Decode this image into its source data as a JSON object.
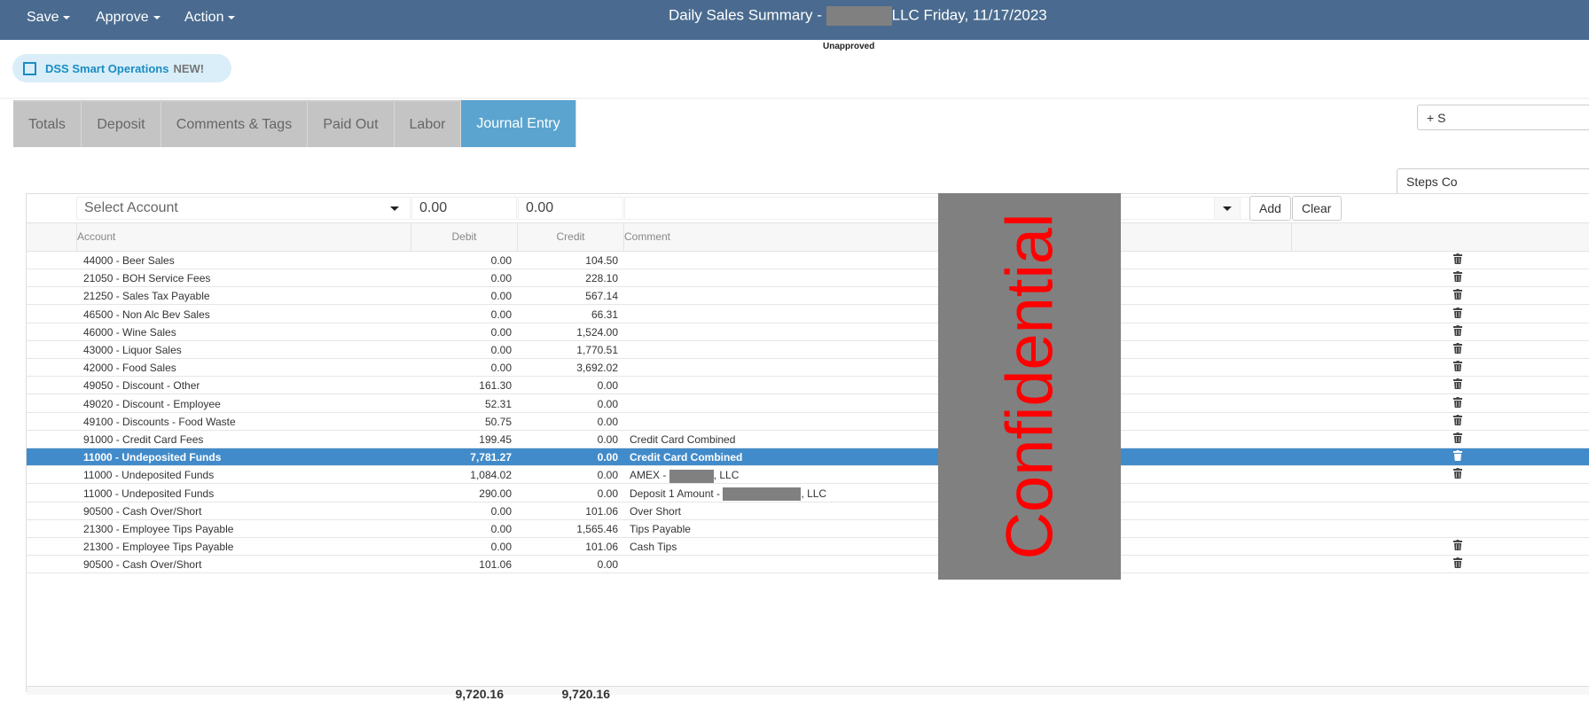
{
  "topbar": {
    "menus": [
      {
        "label": "Save"
      },
      {
        "label": "Approve"
      },
      {
        "label": "Action"
      }
    ],
    "title_prefix": "Daily Sales Summary -",
    "title_suffix": "LLC Friday, 11/17/2023",
    "status": "Unapproved"
  },
  "badge": {
    "label": "DSS Smart Operations",
    "new": "NEW!"
  },
  "tabs": [
    "Totals",
    "Deposit",
    "Comments & Tags",
    "Paid Out",
    "Labor",
    "Journal Entry"
  ],
  "active_tab": "Journal Entry",
  "buttons": {
    "add_section": "+ S",
    "steps": "Steps Co",
    "add": "Add",
    "clear": "Clear"
  },
  "entry": {
    "account_placeholder": "Select Account",
    "debit": "0.00",
    "credit": "0.00",
    "comment": ""
  },
  "columns": {
    "account": "Account",
    "debit": "Debit",
    "credit": "Credit",
    "comment": "Comment"
  },
  "rows": [
    {
      "account": "44000 - Beer Sales",
      "debit": "0.00",
      "credit": "104.50",
      "comment": "",
      "trash": true
    },
    {
      "account": "21050 - BOH Service Fees",
      "debit": "0.00",
      "credit": "228.10",
      "comment": "",
      "trash": true
    },
    {
      "account": "21250 - Sales Tax Payable",
      "debit": "0.00",
      "credit": "567.14",
      "comment": "",
      "trash": true
    },
    {
      "account": "46500 - Non Alc Bev Sales",
      "debit": "0.00",
      "credit": "66.31",
      "comment": "",
      "trash": true
    },
    {
      "account": "46000 - Wine Sales",
      "debit": "0.00",
      "credit": "1,524.00",
      "comment": "",
      "trash": true
    },
    {
      "account": "43000 - Liquor Sales",
      "debit": "0.00",
      "credit": "1,770.51",
      "comment": "",
      "trash": true
    },
    {
      "account": "42000 - Food Sales",
      "debit": "0.00",
      "credit": "3,692.02",
      "comment": "",
      "trash": true
    },
    {
      "account": "49050 - Discount - Other",
      "debit": "161.30",
      "credit": "0.00",
      "comment": "",
      "trash": true
    },
    {
      "account": "49020 - Discount - Employee",
      "debit": "52.31",
      "credit": "0.00",
      "comment": "",
      "trash": true
    },
    {
      "account": "49100 - Discounts - Food Waste",
      "debit": "50.75",
      "credit": "0.00",
      "comment": "",
      "trash": true
    },
    {
      "account": "91000 - Credit Card Fees",
      "debit": "199.45",
      "credit": "0.00",
      "comment": "Credit Card Combined",
      "trash": true
    },
    {
      "account": "11000 - Undeposited Funds",
      "debit": "7,781.27",
      "credit": "0.00",
      "comment": "Credit Card Combined",
      "trash": true,
      "selected": true
    },
    {
      "account": "11000 - Undeposited Funds",
      "debit": "1,084.02",
      "credit": "0.00",
      "comment": "AMEX -",
      "comment_suffix": ", LLC",
      "redact": 50,
      "trash": true
    },
    {
      "account": "11000 - Undeposited Funds",
      "debit": "290.00",
      "credit": "0.00",
      "comment": "Deposit 1 Amount -",
      "comment_suffix": ", LLC",
      "redact": 88,
      "trash": false
    },
    {
      "account": "90500 - Cash Over/Short",
      "debit": "0.00",
      "credit": "101.06",
      "comment": "Over Short",
      "trash": false
    },
    {
      "account": "21300 - Employee Tips Payable",
      "debit": "0.00",
      "credit": "1,565.46",
      "comment": "Tips Payable",
      "trash": false
    },
    {
      "account": "21300 - Employee Tips Payable",
      "debit": "0.00",
      "credit": "101.06",
      "comment": "Cash Tips",
      "trash": true
    },
    {
      "account": "90500 - Cash Over/Short",
      "debit": "101.06",
      "credit": "0.00",
      "comment": "",
      "trash": true
    }
  ],
  "totals": {
    "debit": "9,720.16",
    "credit": "9,720.16"
  },
  "watermark": "Confidential"
}
